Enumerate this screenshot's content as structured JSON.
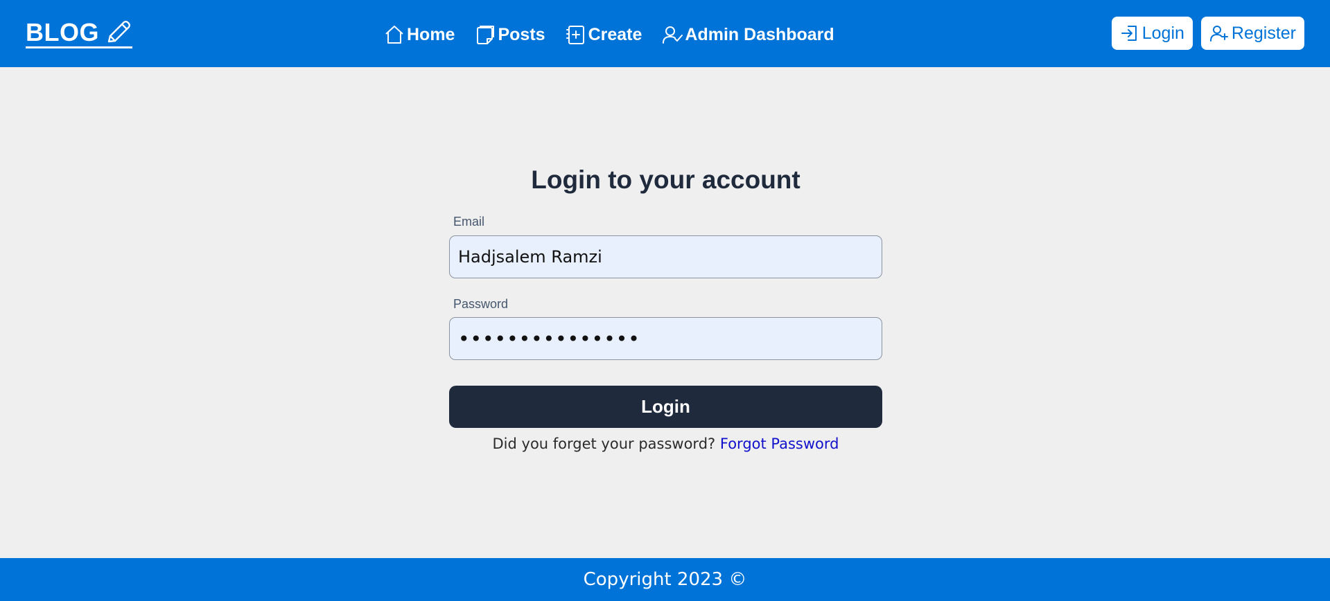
{
  "navbar": {
    "brand": "BLOG",
    "brand_icon": "pencil-icon",
    "links": [
      {
        "label": "Home",
        "icon": "home-icon"
      },
      {
        "label": "Posts",
        "icon": "posts-icon"
      },
      {
        "label": "Create",
        "icon": "create-icon"
      },
      {
        "label": "Admin Dashboard",
        "icon": "admin-icon"
      }
    ],
    "auth": {
      "login_label": "Login",
      "register_label": "Register"
    },
    "color": "#0073d9"
  },
  "form": {
    "title": "Login to your account",
    "email_label": "Email",
    "email_value": "Hadjsalem Ramzi",
    "password_label": "Password",
    "password_value": "•••••••••••••••",
    "submit_label": "Login",
    "forgot_text": "Did you forget your password?",
    "forgot_link": "Forgot Password"
  },
  "footer": {
    "text": "Copyright 2023 ©"
  }
}
